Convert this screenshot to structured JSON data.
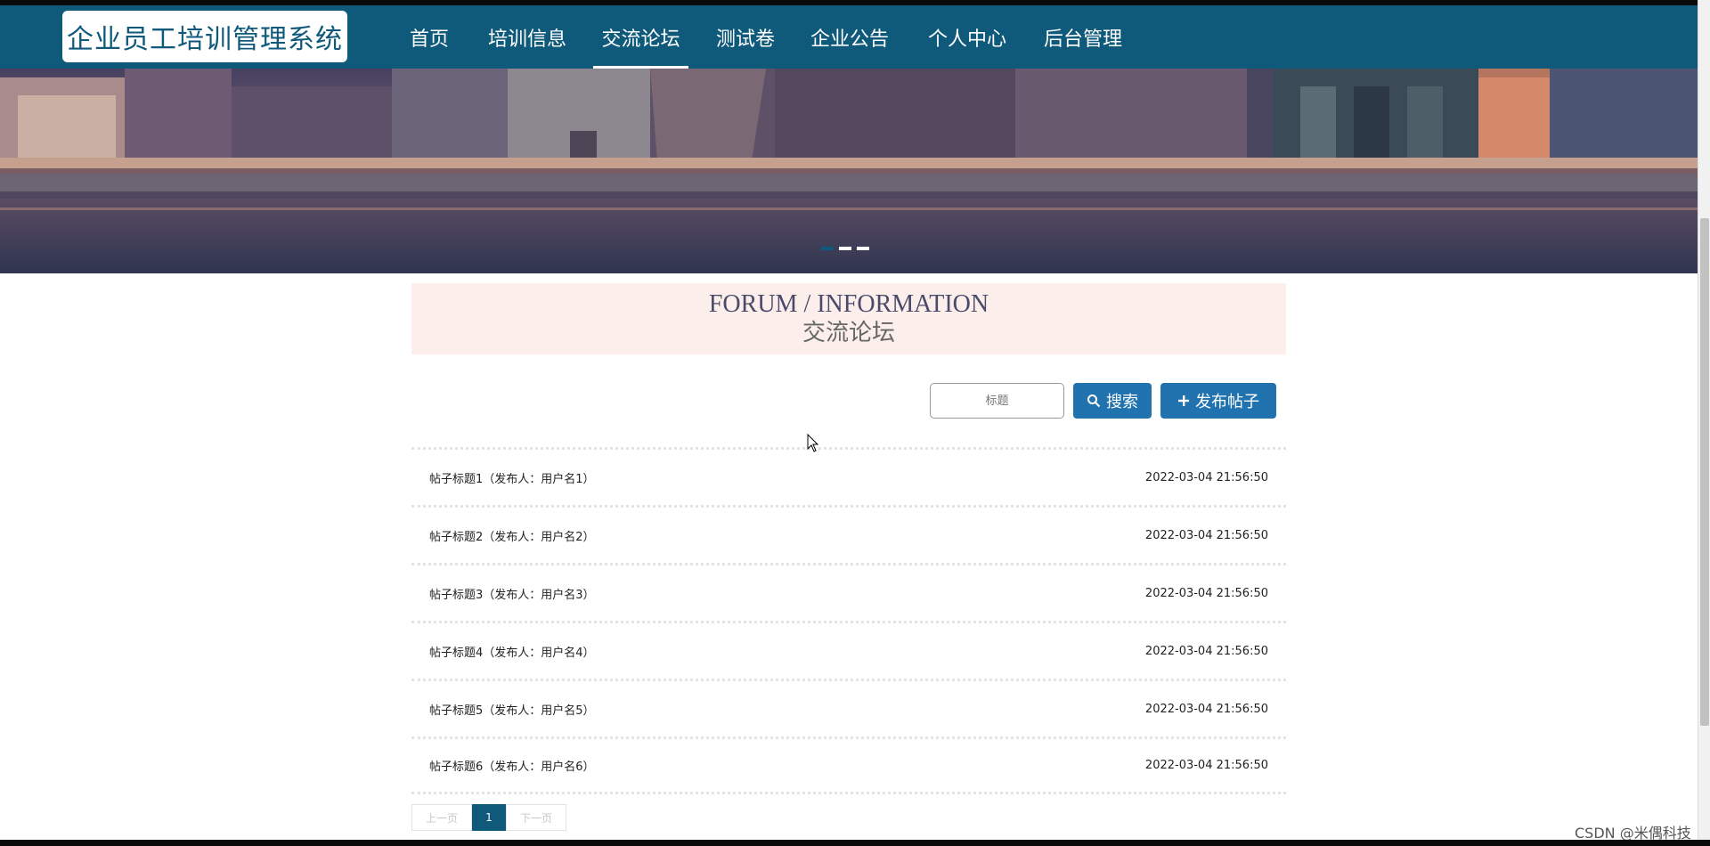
{
  "brand": {
    "title": "企业员工培训管理系统"
  },
  "nav": {
    "items": [
      {
        "label": "首页",
        "active": false
      },
      {
        "label": "培训信息",
        "active": false
      },
      {
        "label": "交流论坛",
        "active": true
      },
      {
        "label": "测试卷",
        "active": false
      },
      {
        "label": "企业公告",
        "active": false
      },
      {
        "label": "个人中心",
        "active": false
      },
      {
        "label": "后台管理",
        "active": false
      }
    ]
  },
  "banner": {
    "slides": 3,
    "active_slide": 1
  },
  "section": {
    "title_en": "FORUM / INFORMATION",
    "title_cn": "交流论坛"
  },
  "search": {
    "placeholder": "标题",
    "search_label": "搜索",
    "post_label": "发布帖子"
  },
  "posts": [
    {
      "title": "帖子标题1（发布人：用户名1）",
      "time": "2022-03-04 21:56:50"
    },
    {
      "title": "帖子标题2（发布人：用户名2）",
      "time": "2022-03-04 21:56:50"
    },
    {
      "title": "帖子标题3（发布人：用户名3）",
      "time": "2022-03-04 21:56:50"
    },
    {
      "title": "帖子标题4（发布人：用户名4）",
      "time": "2022-03-04 21:56:50"
    },
    {
      "title": "帖子标题5（发布人：用户名5）",
      "time": "2022-03-04 21:56:50"
    },
    {
      "title": "帖子标题6（发布人：用户名6）",
      "time": "2022-03-04 21:56:50"
    }
  ],
  "pagination": {
    "prev": "上一页",
    "current": "1",
    "next": "下一页"
  },
  "watermark": "CSDN @米偶科技",
  "colors": {
    "primary": "#0f5a7b",
    "button": "#2173b0",
    "title_bg": "#fcefeb"
  }
}
